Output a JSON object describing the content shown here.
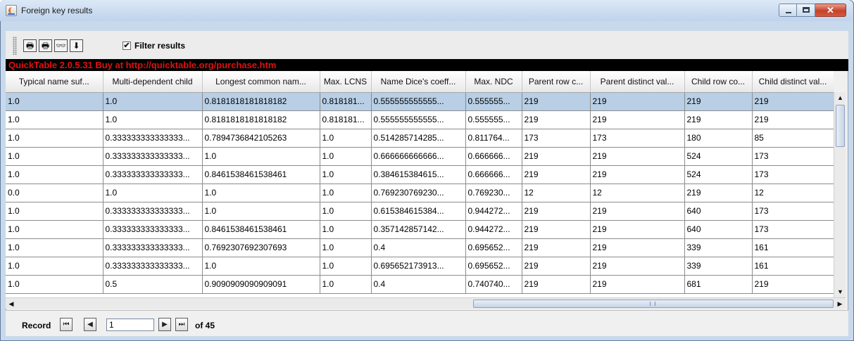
{
  "window": {
    "title": "Foreign key results",
    "controls": {
      "minimize_icon": "minimize-icon",
      "maximize_icon": "maximize-icon",
      "close_label": "✕"
    }
  },
  "toolbar": {
    "buttons": [
      {
        "name": "print-icon",
        "glyph": "🖶"
      },
      {
        "name": "print-preview-icon",
        "glyph": "🖶"
      },
      {
        "name": "find-icon",
        "glyph": "👓"
      },
      {
        "name": "export-icon",
        "glyph": "⬇"
      }
    ],
    "filter_checked": true,
    "filter_check_glyph": "✔",
    "filter_label": "Filter results"
  },
  "banner": {
    "text": "QuickTable 2.0.5.31 Buy at http://quicktable.org/purchase.htm"
  },
  "table": {
    "columns": [
      "Typical name suf...",
      "Multi-dependent child",
      "Longest common nam...",
      "Max. LCNS",
      "Name Dice's coeff...",
      "Max. NDC",
      "Parent row c...",
      "Parent distinct val...",
      "Child row co...",
      "Child distinct val..."
    ],
    "selected_row": 0,
    "rows": [
      [
        "1.0",
        "1.0",
        "0.8181818181818182",
        "0.818181...",
        "0.555555555555...",
        "0.555555...",
        "219",
        "219",
        "219",
        "219"
      ],
      [
        "1.0",
        "1.0",
        "0.8181818181818182",
        "0.818181...",
        "0.555555555555...",
        "0.555555...",
        "219",
        "219",
        "219",
        "219"
      ],
      [
        "1.0",
        "0.333333333333333...",
        "0.7894736842105263",
        "1.0",
        "0.514285714285...",
        "0.811764...",
        "173",
        "173",
        "180",
        "85"
      ],
      [
        "1.0",
        "0.333333333333333...",
        "1.0",
        "1.0",
        "0.666666666666...",
        "0.666666...",
        "219",
        "219",
        "524",
        "173"
      ],
      [
        "1.0",
        "0.333333333333333...",
        "0.8461538461538461",
        "1.0",
        "0.384615384615...",
        "0.666666...",
        "219",
        "219",
        "524",
        "173"
      ],
      [
        "0.0",
        "1.0",
        "1.0",
        "1.0",
        "0.769230769230...",
        "0.769230...",
        "12",
        "12",
        "219",
        "12"
      ],
      [
        "1.0",
        "0.333333333333333...",
        "1.0",
        "1.0",
        "0.615384615384...",
        "0.944272...",
        "219",
        "219",
        "640",
        "173"
      ],
      [
        "1.0",
        "0.333333333333333...",
        "0.8461538461538461",
        "1.0",
        "0.357142857142...",
        "0.944272...",
        "219",
        "219",
        "640",
        "173"
      ],
      [
        "1.0",
        "0.333333333333333...",
        "0.7692307692307693",
        "1.0",
        "0.4",
        "0.695652...",
        "219",
        "219",
        "339",
        "161"
      ],
      [
        "1.0",
        "0.333333333333333...",
        "1.0",
        "1.0",
        "0.695652173913...",
        "0.695652...",
        "219",
        "219",
        "339",
        "161"
      ],
      [
        "1.0",
        "0.5",
        "0.9090909090909091",
        "1.0",
        "0.4",
        "0.740740...",
        "219",
        "219",
        "681",
        "219"
      ]
    ]
  },
  "scrollbars": {
    "up_glyph": "▲",
    "down_glyph": "▼",
    "left_glyph": "◀",
    "right_glyph": "▶"
  },
  "navigator": {
    "label": "Record",
    "first_glyph": "⏮",
    "prev_glyph": "◀",
    "next_glyph": "▶",
    "last_glyph": "⏭",
    "current_record": "1",
    "of_text": "of 45"
  }
}
